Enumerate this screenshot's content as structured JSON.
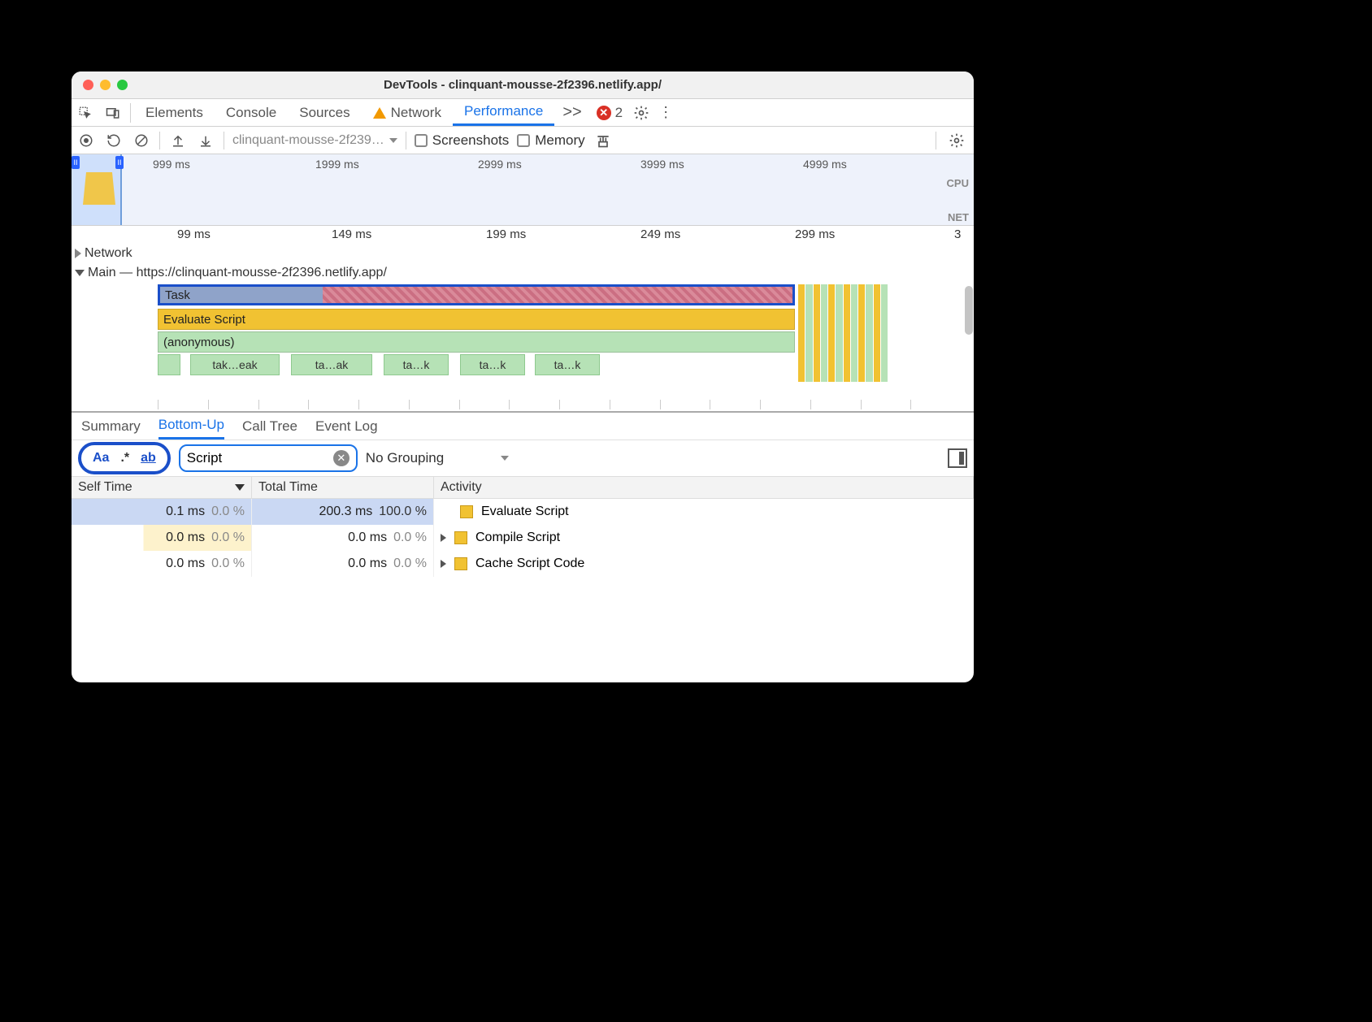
{
  "window": {
    "title": "DevTools - clinquant-mousse-2f2396.netlify.app/"
  },
  "tabs": {
    "elements": "Elements",
    "console": "Console",
    "sources": "Sources",
    "network": "Network",
    "performance": "Performance",
    "expand": ">>",
    "error_count": "2"
  },
  "perfbar": {
    "recording_select": "clinquant-mousse-2f239…",
    "screenshots": "Screenshots",
    "memory": "Memory"
  },
  "overview": {
    "ticks": [
      "999 ms",
      "1999 ms",
      "2999 ms",
      "3999 ms",
      "4999 ms"
    ],
    "cpu_label": "CPU",
    "net_label": "NET"
  },
  "ruler": {
    "ticks": [
      "99 ms",
      "149 ms",
      "199 ms",
      "249 ms",
      "299 ms",
      "3"
    ]
  },
  "lanes": {
    "network": "Network",
    "main": "Main — https://clinquant-mousse-2f2396.netlify.app/"
  },
  "flame": {
    "task": "Task",
    "eval": "Evaluate Script",
    "anon": "(anonymous)",
    "children": [
      "",
      "tak…eak",
      "ta…ak",
      "ta…k",
      "ta…k",
      "ta…k"
    ]
  },
  "detail_tabs": {
    "summary": "Summary",
    "bottom_up": "Bottom-Up",
    "call_tree": "Call Tree",
    "event_log": "Event Log"
  },
  "filter": {
    "match_case": "Aa",
    "regex": ".*",
    "whole_word": "ab",
    "query": "Script",
    "grouping": "No Grouping"
  },
  "table": {
    "headers": {
      "self": "Self Time",
      "total": "Total Time",
      "activity": "Activity"
    },
    "rows": [
      {
        "self_time": "0.1 ms",
        "self_pct": "0.0 %",
        "total_time": "200.3 ms",
        "total_pct": "100.0 %",
        "activity": "Evaluate Script",
        "expandable": false
      },
      {
        "self_time": "0.0 ms",
        "self_pct": "0.0 %",
        "total_time": "0.0 ms",
        "total_pct": "0.0 %",
        "activity": "Compile Script",
        "expandable": true
      },
      {
        "self_time": "0.0 ms",
        "self_pct": "0.0 %",
        "total_time": "0.0 ms",
        "total_pct": "0.0 %",
        "activity": "Cache Script Code",
        "expandable": true
      }
    ]
  }
}
